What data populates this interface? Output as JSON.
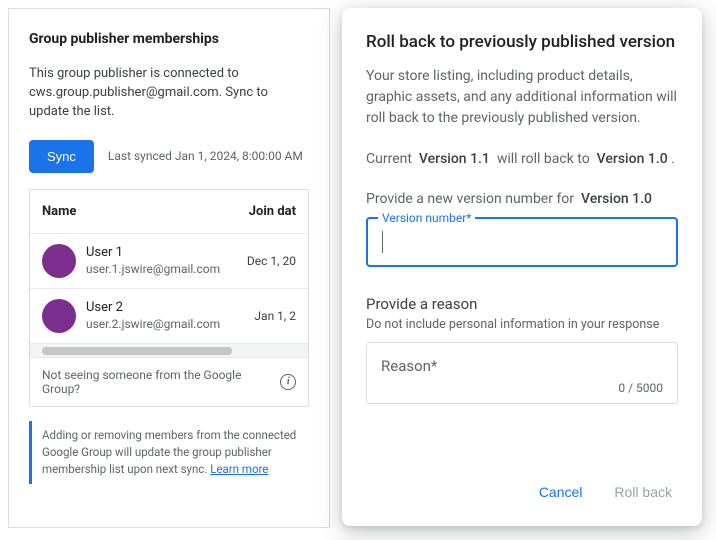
{
  "left": {
    "title": "Group publisher memberships",
    "description": "This group publisher is connected to cws.group.publisher@gmail.com. Sync to update the list.",
    "sync_label": "Sync",
    "last_synced": "Last synced Jan 1, 2024, 8:00:00 AM",
    "columns": {
      "name": "Name",
      "join": "Join dat"
    },
    "rows": [
      {
        "name": "User 1",
        "email": "user.1.jswire@gmail.com",
        "joined": "Dec 1, 20"
      },
      {
        "name": "User 2",
        "email": "user.2.jswire@gmail.com",
        "joined": "Jan 1, 2"
      }
    ],
    "not_seeing": "Not seeing someone from the Google Group?",
    "notice": "Adding or removing members from the connected Google Group will update the group publisher membership list upon next sync.",
    "learn_more": "Learn more"
  },
  "right": {
    "title": "Roll back to previously published version",
    "description": "Your store listing, including product details, graphic assets, and any additional information will roll back to the previously published version.",
    "current_prefix": "Current",
    "current_version": "Version 1.1",
    "current_mid": "will roll back to",
    "target_version": "Version 1.0",
    "period": ".",
    "provide_prefix": "Provide a new version number for",
    "provide_version": "Version 1.0",
    "field_label": "Version number*",
    "field_value": "",
    "reason_title": "Provide a reason",
    "reason_sub": "Do not include personal information in your response",
    "reason_placeholder": "Reason*",
    "reason_count": "0 / 5000",
    "cancel": "Cancel",
    "rollback": "Roll back"
  }
}
